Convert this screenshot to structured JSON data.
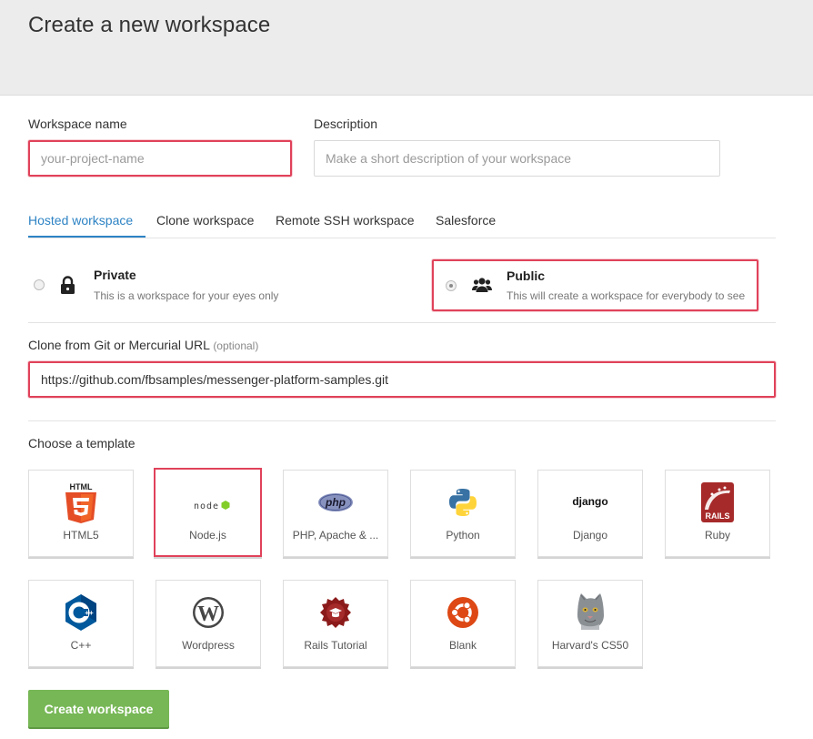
{
  "header": {
    "title": "Create a new workspace"
  },
  "form": {
    "name_label": "Workspace name",
    "name_placeholder": "your-project-name",
    "desc_label": "Description",
    "desc_placeholder": "Make a short description of your workspace"
  },
  "tabs": [
    {
      "label": "Hosted workspace",
      "active": true
    },
    {
      "label": "Clone workspace"
    },
    {
      "label": "Remote SSH workspace"
    },
    {
      "label": "Salesforce"
    }
  ],
  "visibility": {
    "private": {
      "title": "Private",
      "desc": "This is a workspace for your eyes only",
      "icon": "lock-icon"
    },
    "public": {
      "title": "Public",
      "desc": "This will create a workspace for everybody to see",
      "icon": "users-icon",
      "selected": true
    }
  },
  "clone": {
    "label": "Clone from Git or Mercurial URL",
    "optional": "(optional)",
    "value": "https://github.com/fbsamples/messenger-platform-samples.git"
  },
  "templates_label": "Choose a template",
  "templates": [
    {
      "name": "HTML5",
      "icon": "html5-icon",
      "logo_text": "HTML"
    },
    {
      "name": "Node.js",
      "icon": "nodejs-icon",
      "logo_text": "node",
      "selected": true
    },
    {
      "name": "PHP, Apache & ...",
      "icon": "php-icon",
      "logo_text": "php"
    },
    {
      "name": "Python",
      "icon": "python-icon"
    },
    {
      "name": "Django",
      "icon": "django-icon",
      "logo_text": "django"
    },
    {
      "name": "Ruby",
      "icon": "rails-icon",
      "logo_text": "RAILS"
    },
    {
      "name": "C++",
      "icon": "cpp-icon",
      "logo_text": "C"
    },
    {
      "name": "Wordpress",
      "icon": "wordpress-icon",
      "logo_text": "W"
    },
    {
      "name": "Rails Tutorial",
      "icon": "rails-tutorial-icon"
    },
    {
      "name": "Blank",
      "icon": "ubuntu-icon"
    },
    {
      "name": "Harvard's CS50",
      "icon": "cat-icon"
    }
  ],
  "create_button": "Create workspace",
  "colors": {
    "accent": "#2d83c4",
    "highlight": "#e0425a",
    "create": "#77b756"
  }
}
